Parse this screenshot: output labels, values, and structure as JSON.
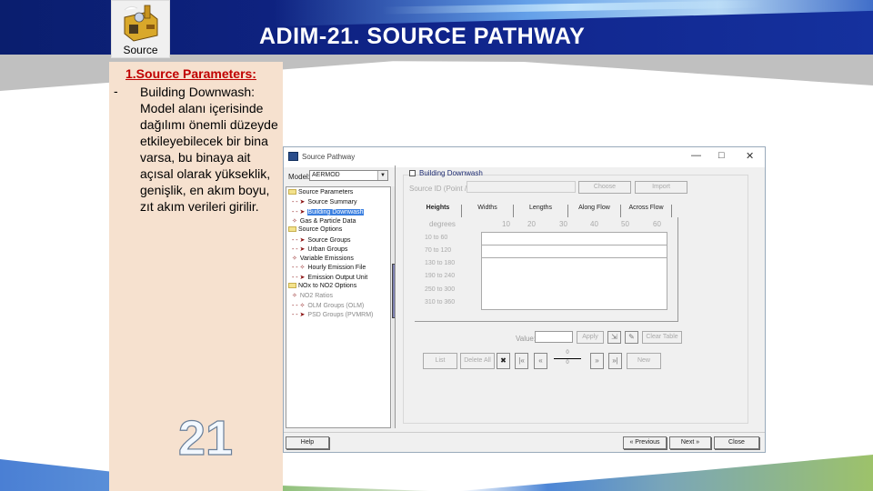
{
  "slide": {
    "title": "ADIM-21. SOURCE PATHWAY",
    "icon_label": "Source",
    "note_heading": "1.Source Parameters:",
    "note_bullet": "-",
    "note_text": "Building Downwash: Model alanı içerisinde dağılımı önemli düzeyde etkileyebilecek bir bina varsa, bu binaya ait açısal olarak yükseklik, genişlik, en akım boyu, zıt akım verileri girilir.",
    "slide_number": "21"
  },
  "dialog": {
    "title": "Source Pathway",
    "controls": {
      "minimize": "—",
      "maximize": "□",
      "close": "✕"
    },
    "model_label": "Model:",
    "model_value": "AERMOD",
    "tree": [
      {
        "label": "Source Parameters",
        "type": "folder"
      },
      {
        "label": "Source Summary",
        "type": "item",
        "prefix": "- - ➤"
      },
      {
        "label": "Building Downwash",
        "type": "item",
        "prefix": "- - ➤",
        "selected": true
      },
      {
        "label": "Gas & Particle Data",
        "type": "item",
        "prefix": "✧"
      },
      {
        "label": "Source Options",
        "type": "folder"
      },
      {
        "label": "Source Groups",
        "type": "item",
        "prefix": "- - ➤"
      },
      {
        "label": "Urban Groups",
        "type": "item",
        "prefix": "- - ➤"
      },
      {
        "label": "Variable Emissions",
        "type": "item",
        "prefix": "✧"
      },
      {
        "label": "Hourly Emission File",
        "type": "item",
        "prefix": "- - ✧"
      },
      {
        "label": "Emission Output Unit",
        "type": "item",
        "prefix": "- - ➤"
      },
      {
        "label": "NOx to NO2 Options",
        "type": "folder"
      },
      {
        "label": "NO2 Ratios",
        "type": "item",
        "prefix": "✧",
        "dim": true
      },
      {
        "label": "OLM Groups (OLM)",
        "type": "item",
        "prefix": "- - ✧",
        "dim": true
      },
      {
        "label": "PSD Groups (PVMRM)",
        "type": "item",
        "prefix": "- - ➤",
        "dim": true
      }
    ],
    "building_downwash_label": "Building Downwash",
    "building_downwash_checked": false,
    "source_id_label": "Source ID (Point / Flare):",
    "choose_label": "Choose",
    "import_label": "Import",
    "tabs": [
      "Heights",
      "Widths",
      "Lengths",
      "Along Flow",
      "Across Flow"
    ],
    "active_tab": "Heights",
    "degrees_label": "degrees",
    "degree_columns": [
      "10",
      "20",
      "30",
      "40",
      "50",
      "60"
    ],
    "row_ranges": [
      "10 to 60",
      "70 to 120",
      "130 to 180",
      "190 to 240",
      "250 to 300",
      "310 to 360"
    ],
    "value_label": "Value:",
    "value_input": "",
    "apply_label": "Apply",
    "clear_table_label": "Clear Table",
    "list_label": "List",
    "delete_all_label": "Delete All",
    "new_label": "New",
    "record_current": "0",
    "record_total": "0",
    "help_label": "Help",
    "previous_label": "Previous",
    "next_label": "Next",
    "close_label": "Close"
  }
}
